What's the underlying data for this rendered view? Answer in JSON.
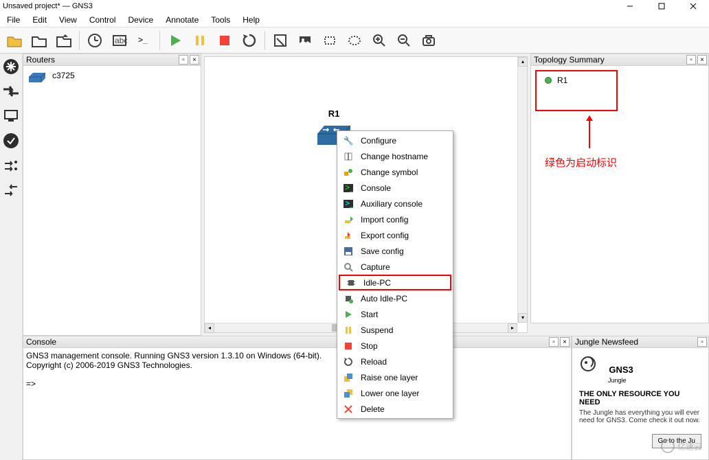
{
  "window": {
    "title": "Unsaved project* — GNS3"
  },
  "menu": {
    "items": [
      "File",
      "Edit",
      "View",
      "Control",
      "Device",
      "Annotate",
      "Tools",
      "Help"
    ]
  },
  "routers_panel": {
    "title": "Routers",
    "items": [
      {
        "name": "c3725"
      }
    ]
  },
  "topology_panel": {
    "title": "Topology Summary",
    "items": [
      {
        "name": "R1",
        "status": "running"
      }
    ]
  },
  "console_panel": {
    "title": "Console",
    "line1": "GNS3 management console. Running GNS3 version 1.3.10 on Windows (64-bit).",
    "line2": "Copyright (c) 2006-2019 GNS3 Technologies.",
    "prompt": "=>"
  },
  "jungle_panel": {
    "title": "Jungle Newsfeed",
    "logo_text": "GNS3",
    "logo_sub": "Jungle",
    "headline": "THE ONLY RESOURCE YOU NEED",
    "body": "The Jungle has everything you will ever need for GNS3. Come check it out now.",
    "button": "Go to the Ju"
  },
  "canvas": {
    "device_label": "R1"
  },
  "annotation": {
    "text": "绿色为启动标识"
  },
  "context_menu": {
    "items": [
      {
        "label": "Configure",
        "icon": "wrench"
      },
      {
        "label": "Change hostname",
        "icon": "text-cursor"
      },
      {
        "label": "Change symbol",
        "icon": "shapes"
      },
      {
        "label": "Console",
        "icon": "terminal"
      },
      {
        "label": "Auxiliary console",
        "icon": "terminal-aux"
      },
      {
        "label": "Import config",
        "icon": "import"
      },
      {
        "label": "Export config",
        "icon": "export"
      },
      {
        "label": "Save config",
        "icon": "save"
      },
      {
        "label": "Capture",
        "icon": "magnifier"
      },
      {
        "label": "Idle-PC",
        "icon": "chip",
        "highlighted": true
      },
      {
        "label": "Auto Idle-PC",
        "icon": "chip-auto"
      },
      {
        "label": "Start",
        "icon": "play"
      },
      {
        "label": "Suspend",
        "icon": "pause"
      },
      {
        "label": "Stop",
        "icon": "stop"
      },
      {
        "label": "Reload",
        "icon": "reload"
      },
      {
        "label": "Raise one layer",
        "icon": "layer-up"
      },
      {
        "label": "Lower one layer",
        "icon": "layer-down"
      },
      {
        "label": "Delete",
        "icon": "delete"
      }
    ]
  },
  "watermark": {
    "text": "亿速云"
  }
}
